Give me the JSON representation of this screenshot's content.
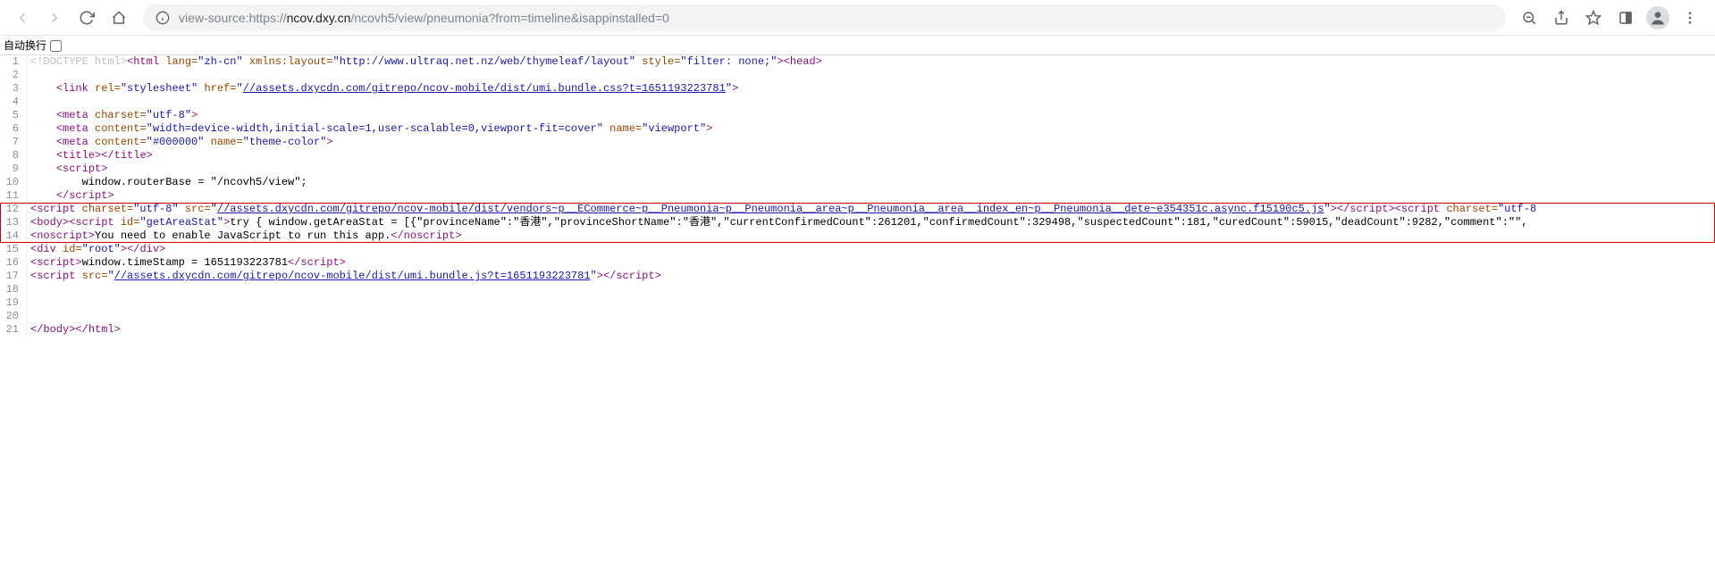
{
  "toolbar": {
    "url_prefix": "view-source:",
    "url_protocol": "https://",
    "url_host": "ncov.dxy.cn",
    "url_path": "/ncovh5/view/pneumonia?from=timeline&isappinstalled=0"
  },
  "autowrap": {
    "label": "自动换行"
  },
  "lines": {
    "1": {
      "num": "1"
    },
    "2": {
      "num": "2"
    },
    "3": {
      "num": "3"
    },
    "4": {
      "num": "4"
    },
    "5": {
      "num": "5"
    },
    "6": {
      "num": "6"
    },
    "7": {
      "num": "7"
    },
    "8": {
      "num": "8"
    },
    "9": {
      "num": "9"
    },
    "10": {
      "num": "10"
    },
    "11": {
      "num": "11"
    },
    "12": {
      "num": "12"
    },
    "13": {
      "num": "13"
    },
    "14": {
      "num": "14"
    },
    "15": {
      "num": "15"
    },
    "16": {
      "num": "16"
    },
    "17": {
      "num": "17"
    },
    "18": {
      "num": "18"
    },
    "19": {
      "num": "19"
    },
    "20": {
      "num": "20"
    },
    "21": {
      "num": "21"
    }
  },
  "src": {
    "doctype": "<!DOCTYPE html>",
    "html_open": "<html",
    "lang_attr": " lang=",
    "lang_val": "\"zh-cn\"",
    "xmlns_attr": " xmlns:layout=",
    "xmlns_val": "\"http://www.ultraq.net.nz/web/thymeleaf/layout\"",
    "style_attr": " style=",
    "style_val": "\"filter: none;\"",
    "gt": ">",
    "head_open": "<head>",
    "indent1": "    ",
    "indent2": "        ",
    "link_open": "<link",
    "rel_attr": " rel=",
    "rel_val": "\"stylesheet\"",
    "href_attr": " href=",
    "href_open_q": "\"",
    "css_url": "//assets.dxycdn.com/gitrepo/ncov-mobile/dist/umi.bundle.css?t=1651193223781",
    "href_close_q": "\"",
    "self_close": ">",
    "meta1_open": "<meta",
    "charset_attr": " charset=",
    "charset_val": "\"utf-8\"",
    "meta2_content_attr": " content=",
    "meta2_content_val": "\"width=device-width,initial-scale=1,user-scalable=0,viewport-fit=cover\"",
    "name_attr": " name=",
    "viewport_val": "\"viewport\"",
    "meta3_content_val": "\"#000000\"",
    "theme_val": "\"theme-color\"",
    "title_open": "<title>",
    "title_close": "</title>",
    "script_open": "<script>",
    "routerbase": "window.routerBase = \"/ncovh5/view\";",
    "script_close_tag": "</script>",
    "l12_script_open": "<script",
    "src_attr": " src=",
    "vendors_url": "//assets.dxycdn.com/gitrepo/ncov-mobile/dist/vendors~p__ECommerce~p__Pneumonia~p__Pneumonia__area~p__Pneumonia__area__index_en~p__Pneumonia__dete~e354351c.async.f15190c5.js",
    "script2_charset": "\"utf-8",
    "body_open": "<body>",
    "script_id_open": "<script",
    "id_attr": " id=",
    "id_val": "\"getAreaStat\"",
    "l13_js_try": "try { window.getAreaStat = [{\"provinceName\":\"香港\",\"provinceShortName\":\"香港\",\"currentConfirmedCount\":261201,\"confirmedCount\":329498,\"suspectedCount\":181,\"curedCount\":59015,\"deadCount\":9282,\"comment\":\"\",",
    "noscript_open": "<noscript>",
    "noscript_text": "You need to enable JavaScript to run this app.",
    "noscript_close": "</noscript>",
    "div_open": "<div",
    "root_val": "\"root\"",
    "div_close": "</div>",
    "timestamp_js": "window.timeStamp = 1651193223781",
    "umi_js_url": "//assets.dxycdn.com/gitrepo/ncov-mobile/dist/umi.bundle.js?t=1651193223781",
    "body_close": "</body>",
    "html_close": "</html>"
  }
}
